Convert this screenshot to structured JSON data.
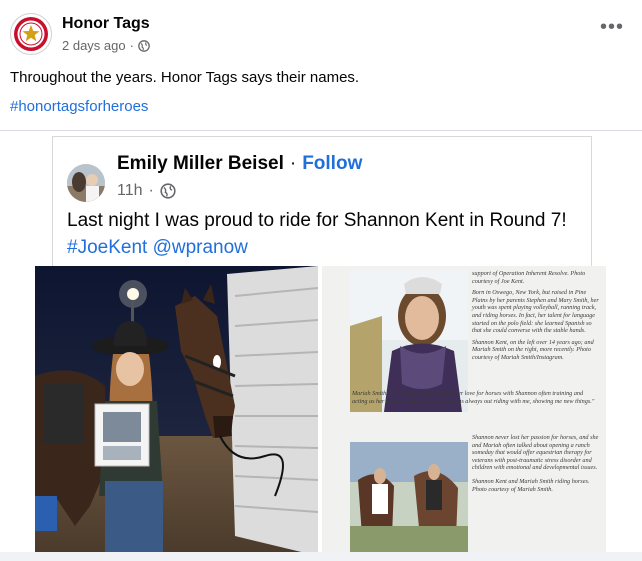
{
  "post": {
    "page_name": "Honor Tags",
    "timestamp": "2 days ago",
    "dot": "·",
    "more": "•••",
    "text": "Throughout the years. Honor Tags says their names.",
    "hashtag": "#honortagsforheroes"
  },
  "shared_post": {
    "author": "Emily Miller Beisel",
    "separator": "·",
    "follow_label": "Follow",
    "time": "11h",
    "dot": "·",
    "text_main": "Last night I was proud to ride for Shannon Kent in Round 7! ",
    "hashtag": "#JoeKent",
    "mention": "@wpranow"
  },
  "article": {
    "p1": "support of Operation Inherent Resolve. Photo courtesy of Joe Kent.",
    "p2": "Born in Oswego, New York, but raised in Pine Plains by her parents Stephen and Mary Smith, her youth was spent playing volleyball, running track, and riding horses. In fact, her talent for language started on the polo field: she learned Spanish so that she could converse with the stable hands.",
    "p3": "Shannon Kent, on the left over 14 years ago; and Mariah Smith on the right, more recently. Photo courtesy of Mariah Smith/Instagram.",
    "p4": "Mariah Smith, her younger sister, shared her love for horses with Shannon often training and acting as her mentor. \"Since I was 5, she was always out riding with me, showing me new things.\"",
    "p5": "Shannon never lost her passion for horses, and she and Mariah often talked about opening a ranch someday that would offer equestrian therapy for veterans with post-traumatic stress disorder and children with emotional and developmental issues.",
    "p6": "Shannon Kent and Mariah Smith riding horses. Photo courtesy of Mariah Smith."
  },
  "colors": {
    "link": "#216fdb",
    "secondary_text": "#65676b",
    "divider": "#dadde1"
  },
  "icons": {
    "privacy": "globe-icon",
    "more": "more-options-icon",
    "page_avatar": "honor-tags-star-logo"
  }
}
